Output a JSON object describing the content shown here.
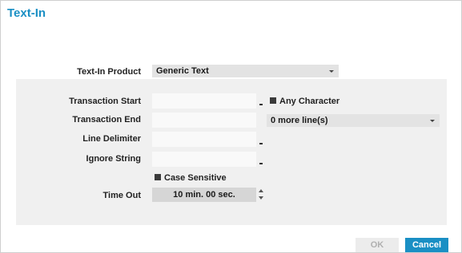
{
  "dialog": {
    "title": "Text-In"
  },
  "product": {
    "label": "Text-In Product",
    "value": "Generic Text"
  },
  "transaction_start": {
    "label": "Transaction Start",
    "value": "",
    "any_character_label": "Any Character"
  },
  "transaction_end": {
    "label": "Transaction End",
    "value": "",
    "lines_value": "0 more line(s)"
  },
  "line_delimiter": {
    "label": "Line Delimiter",
    "value": ""
  },
  "ignore_string": {
    "label": "Ignore String",
    "value": ""
  },
  "case_sensitive": {
    "label": "Case Sensitive"
  },
  "time_out": {
    "label": "Time Out",
    "value": "10 min. 00 sec."
  },
  "buttons": {
    "ok": "OK",
    "cancel": "Cancel"
  },
  "colors": {
    "accent": "#1a8fc4",
    "panel_bg": "#f0f0f0",
    "disabled_text": "#b0b0b0"
  }
}
